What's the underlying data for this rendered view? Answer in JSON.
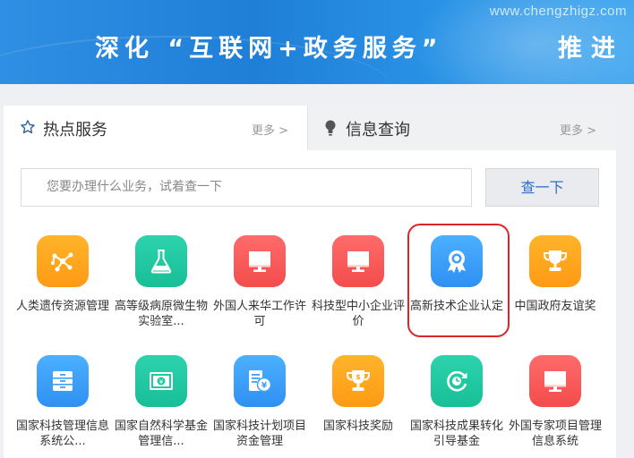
{
  "banner": {
    "watermark": "www.chengzhigz.com",
    "slogan": "深化 “互联网+政务服务”",
    "slogan_tail": "推进"
  },
  "tabs": {
    "hot": {
      "label": "热点服务",
      "more": "更多 >"
    },
    "info": {
      "label": "信息查询",
      "more": "更多 >"
    }
  },
  "search": {
    "placeholder": "您要办理什么业务，试着查一下",
    "button": "查一下"
  },
  "services_row1": [
    {
      "label": "人类遗传资源管理",
      "icon": "molecule-icon",
      "color": "#ffa51e"
    },
    {
      "label": "高等级病原微生物实验室...",
      "icon": "flask-icon",
      "color": "#21c9a1"
    },
    {
      "label": "外国人来华工作许可",
      "icon": "monitor-icon",
      "color": "#f85b5b"
    },
    {
      "label": "科技型中小企业评价",
      "icon": "monitor-icon",
      "color": "#f85b5b"
    },
    {
      "label": "高新技术企业认定",
      "icon": "award-icon",
      "color": "#3da0fa"
    },
    {
      "label": "中国政府友谊奖",
      "icon": "trophy-icon",
      "color": "#ffa51e"
    }
  ],
  "services_row2": [
    {
      "label": "国家科技管理信息系统公...",
      "icon": "cabinet-icon",
      "color": "#3da0fa"
    },
    {
      "label": "国家自然科学基金管理信...",
      "icon": "money-icon",
      "color": "#21c9a1"
    },
    {
      "label": "国家科技计划项目资金管理",
      "icon": "fund-icon",
      "color": "#3da0fa"
    },
    {
      "label": "国家科技奖励",
      "icon": "trophy-icon",
      "color": "#ffa51e"
    },
    {
      "label": "国家科技成果转化引导基金",
      "icon": "cycle-icon",
      "color": "#21c9a1"
    },
    {
      "label": "外国专家项目管理信息系统",
      "icon": "monitor-icon",
      "color": "#f85b5b"
    }
  ]
}
